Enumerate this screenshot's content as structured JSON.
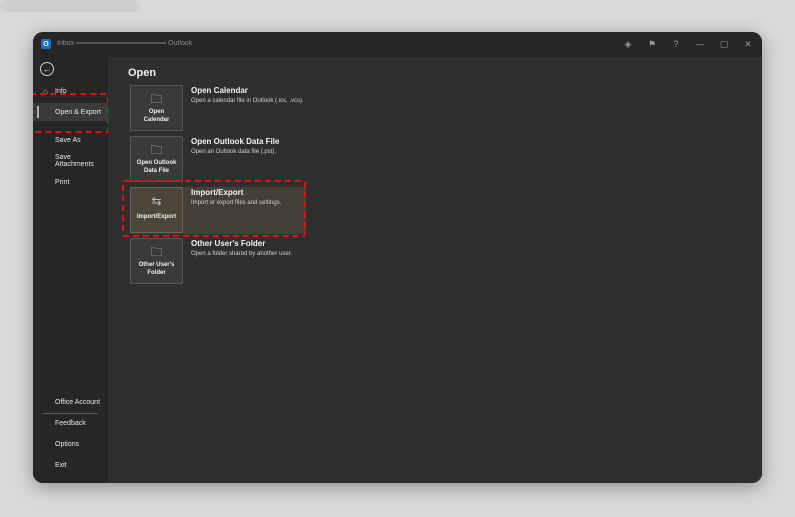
{
  "window": {
    "title_prefix": "Inbox",
    "title_suffix": "Outlook",
    "app_icon_letter": "O",
    "buttons": {
      "gem": "◈",
      "feedback": "⚑",
      "help": "?",
      "minimize": "—",
      "maximize": "▢",
      "close": "✕"
    }
  },
  "sidebar": {
    "back_glyph": "←",
    "items": [
      {
        "label": "Info"
      },
      {
        "label": "Open & Export"
      },
      {
        "label": "Save As"
      },
      {
        "label": "Save Attachments"
      },
      {
        "label": "Print"
      }
    ],
    "bottom_items": [
      {
        "label": "Office Account"
      },
      {
        "label": "Feedback"
      },
      {
        "label": "Options"
      },
      {
        "label": "Exit"
      }
    ]
  },
  "main": {
    "title": "Open",
    "options": [
      {
        "tile_label": "Open\nCalendar",
        "title": "Open Calendar",
        "description": "Open a calendar file in Outlook (.ics, .vcs)."
      },
      {
        "tile_label": "Open Outlook\nData File",
        "title": "Open Outlook Data File",
        "description": "Open an Outlook data file (.pst)."
      },
      {
        "tile_label": "Import/Export",
        "title": "Import/Export",
        "description": "Import or export files and settings."
      },
      {
        "tile_label": "Other User's\nFolder",
        "title": "Other User's Folder",
        "description": "Open a folder shared by another user."
      }
    ]
  },
  "colors": {
    "highlight": "#e01010",
    "selected_bg": "#454036"
  }
}
